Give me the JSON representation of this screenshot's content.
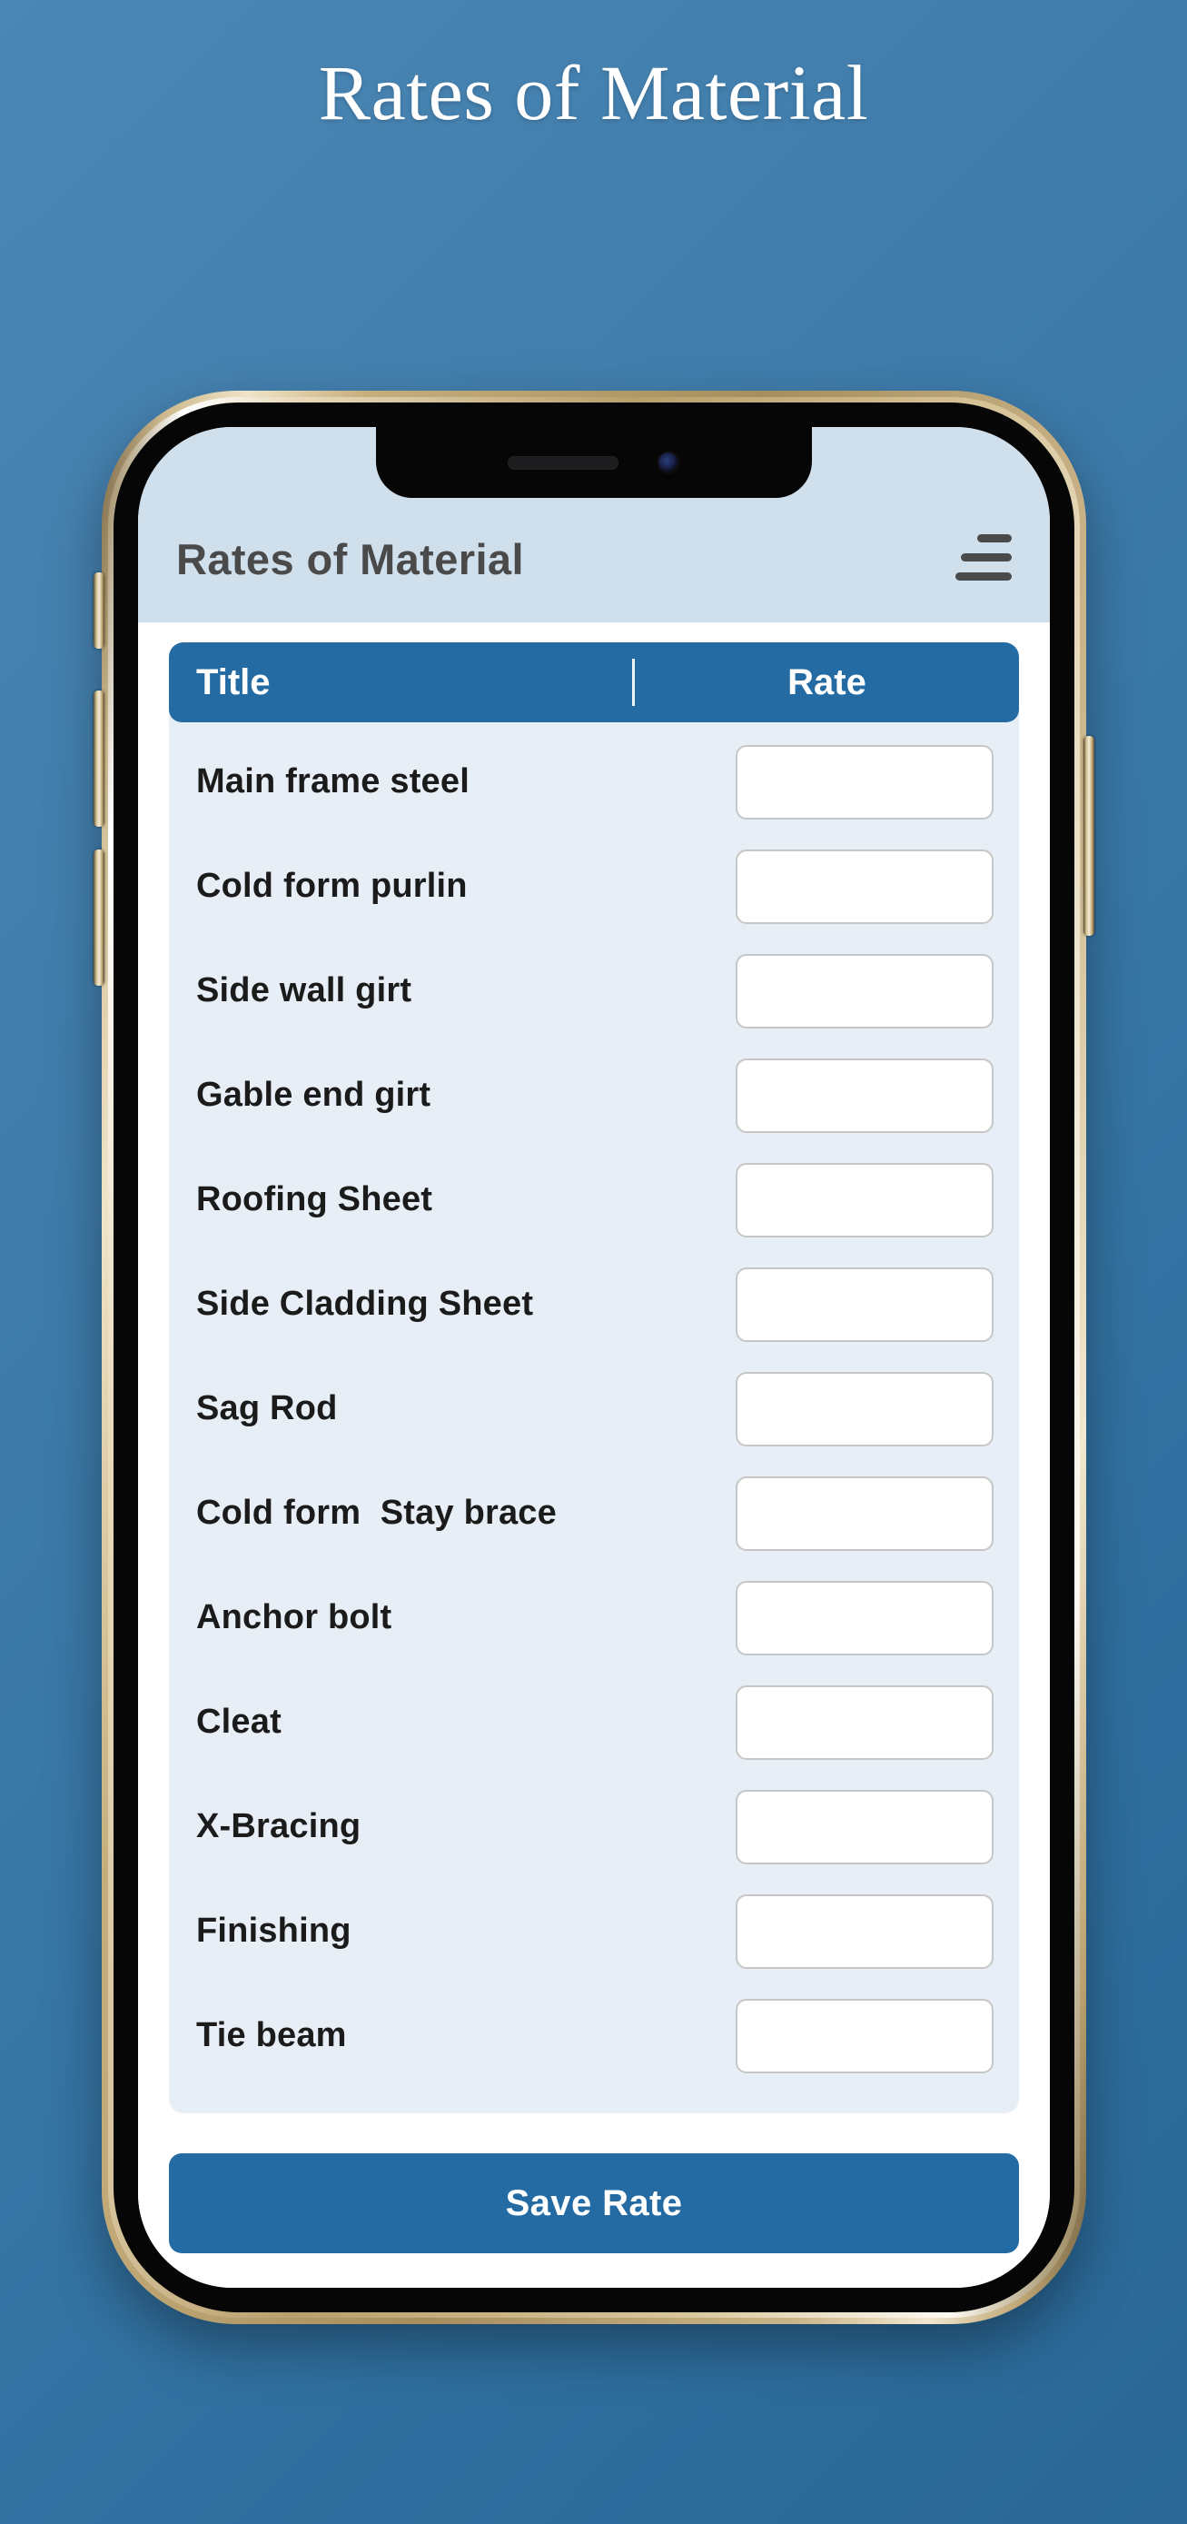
{
  "page": {
    "heading": "Rates of Material",
    "background_color": "#3f7cab"
  },
  "app": {
    "bar": {
      "title": "Rates of Material",
      "menu_icon": "hamburger-menu-icon",
      "background_color": "#d0dfec",
      "title_color": "#4a4a4a"
    },
    "table": {
      "accent_color": "#256ba3",
      "panel_color": "#e7eef6",
      "columns": [
        {
          "key": "title",
          "label": "Title"
        },
        {
          "key": "rate",
          "label": "Rate"
        }
      ],
      "rows": [
        {
          "title": "Main frame steel",
          "rate": ""
        },
        {
          "title": "Cold form purlin",
          "rate": ""
        },
        {
          "title": "Side wall girt",
          "rate": ""
        },
        {
          "title": "Gable end girt",
          "rate": ""
        },
        {
          "title": "Roofing Sheet",
          "rate": ""
        },
        {
          "title": "Side Cladding Sheet",
          "rate": ""
        },
        {
          "title": "Sag Rod",
          "rate": ""
        },
        {
          "title": "Cold form  Stay brace",
          "rate": ""
        },
        {
          "title": "Anchor bolt",
          "rate": ""
        },
        {
          "title": "Cleat",
          "rate": ""
        },
        {
          "title": "X-Bracing",
          "rate": ""
        },
        {
          "title": "Finishing",
          "rate": ""
        },
        {
          "title": "Tie beam",
          "rate": ""
        }
      ]
    },
    "actions": {
      "save_label": "Save Rate"
    }
  },
  "device": {
    "frame_color": "#c6ae7c",
    "bezel_color": "#060606",
    "notch": {
      "speaker_icon": "speaker-grille-icon",
      "camera_icon": "front-camera-icon"
    },
    "buttons": [
      {
        "name": "silent-switch"
      },
      {
        "name": "volume-up-button"
      },
      {
        "name": "volume-down-button"
      },
      {
        "name": "power-button"
      }
    ]
  }
}
